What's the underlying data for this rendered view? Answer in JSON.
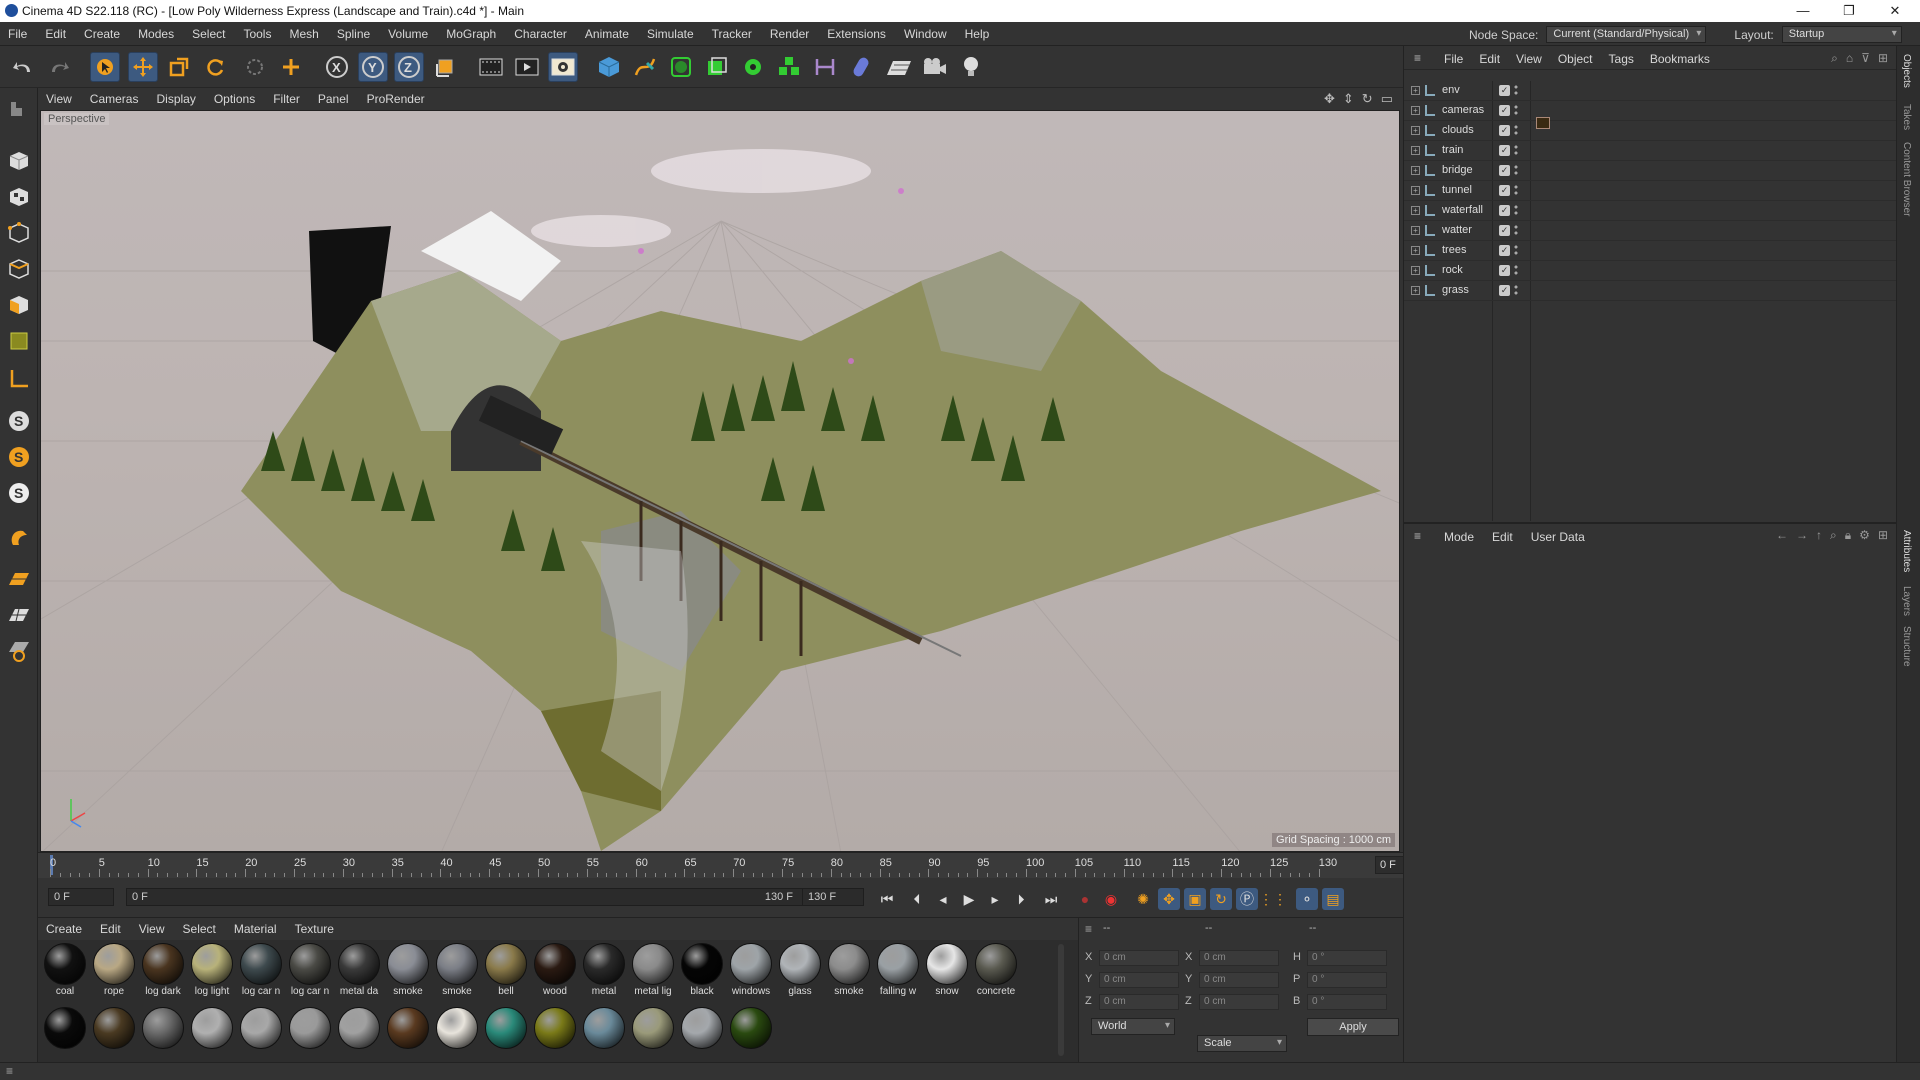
{
  "window": {
    "title": "Cinema 4D S22.118 (RC) - [Low Poly Wilderness Express (Landscape and Train).c4d *] - Main",
    "controls": [
      "—",
      "❐",
      "✕"
    ]
  },
  "menubar": {
    "items": [
      "File",
      "Edit",
      "Create",
      "Modes",
      "Select",
      "Tools",
      "Mesh",
      "Spline",
      "Volume",
      "MoGraph",
      "Character",
      "Animate",
      "Simulate",
      "Tracker",
      "Render",
      "Extensions",
      "Window",
      "Help"
    ],
    "node_space_label": "Node Space:",
    "node_space_value": "Current (Standard/Physical)",
    "layout_label": "Layout:",
    "layout_value": "Startup"
  },
  "viewport": {
    "menu": [
      "View",
      "Cameras",
      "Display",
      "Options",
      "Filter",
      "Panel",
      "ProRender"
    ],
    "label": "Perspective",
    "grid_spacing": "Grid Spacing : 1000 cm"
  },
  "timeline": {
    "ticks": [
      "0",
      "5",
      "10",
      "15",
      "20",
      "25",
      "30",
      "35",
      "40",
      "45",
      "50",
      "55",
      "60",
      "65",
      "70",
      "75",
      "80",
      "85",
      "90",
      "95",
      "100",
      "105",
      "110",
      "115",
      "120",
      "125",
      "130"
    ],
    "current_frame": "0 F"
  },
  "transport": {
    "start_field": "0 F",
    "range_start": "0 F",
    "range_end": "130 F",
    "end_field": "130 F"
  },
  "materials": {
    "menu": [
      "Create",
      "Edit",
      "View",
      "Select",
      "Material",
      "Texture"
    ],
    "row1": [
      {
        "label": "coal",
        "color": "#111111"
      },
      {
        "label": "rope",
        "color": "#b9a884"
      },
      {
        "label": "log dark",
        "color": "#4a3520"
      },
      {
        "label": "log light",
        "color": "#b8b27a"
      },
      {
        "label": "log car n",
        "color": "#3e4a4e"
      },
      {
        "label": "log car n",
        "color": "#4a4a45"
      },
      {
        "label": "metal da",
        "color": "#3a3a3a"
      },
      {
        "label": "smoke",
        "color": "#8a8d95"
      },
      {
        "label": "smoke",
        "color": "#7b7e86"
      },
      {
        "label": "bell",
        "color": "#8a7a4a"
      },
      {
        "label": "wood",
        "color": "#2a1a12"
      },
      {
        "label": "metal",
        "color": "#2a2a2a"
      },
      {
        "label": "metal lig",
        "color": "#8a8a8a"
      },
      {
        "label": "black",
        "color": "#050505"
      },
      {
        "label": "windows",
        "color": "#9ea4a8"
      },
      {
        "label": "glass",
        "color": "#b0b4b8"
      },
      {
        "label": "smoke",
        "color": "#8c8c8c"
      },
      {
        "label": "falling w",
        "color": "#9aa0a4"
      },
      {
        "label": "snow",
        "color": "#e6e6e6"
      },
      {
        "label": "concrete",
        "color": "#5a5a50"
      }
    ],
    "row2": [
      "#0a0a0a",
      "#4a3a22",
      "#6a6a6a",
      "#b0b0b0",
      "#a8a8a8",
      "#9a9a9a",
      "#a0a0a0",
      "#5a3a20",
      "#e8e4dc",
      "#2a8a7a",
      "#7a7a18",
      "#6a8a9a",
      "#9a9a7a",
      "#a4a8ac",
      "#2a4a10"
    ]
  },
  "coordinates": {
    "header": [
      "--",
      "--",
      "--"
    ],
    "rows": [
      {
        "a": "X",
        "av": "0 cm",
        "b": "X",
        "bv": "0 cm",
        "c": "H",
        "cv": "0 °"
      },
      {
        "a": "Y",
        "av": "0 cm",
        "b": "Y",
        "bv": "0 cm",
        "c": "P",
        "cv": "0 °"
      },
      {
        "a": "Z",
        "av": "0 cm",
        "b": "Z",
        "bv": "0 cm",
        "c": "B",
        "cv": "0 °"
      }
    ],
    "space": "World",
    "mode": "Scale",
    "apply": "Apply"
  },
  "objects": {
    "menu": [
      "File",
      "Edit",
      "View",
      "Object",
      "Tags",
      "Bookmarks"
    ],
    "items": [
      "env",
      "cameras",
      "clouds",
      "train",
      "bridge",
      "tunnel",
      "waterfall",
      "watter",
      "trees",
      "rock",
      "grass"
    ]
  },
  "attributes": {
    "menu": [
      "Mode",
      "Edit",
      "User Data"
    ]
  },
  "right_tabs": {
    "top": [
      "Objects",
      "Takes",
      "Content Browser"
    ],
    "bottom": [
      "Attributes",
      "Layers",
      "Structure"
    ]
  },
  "colors": {
    "accent": "#3d5a80",
    "panel": "#333333",
    "viewport_bg": "#bdb4b2"
  }
}
